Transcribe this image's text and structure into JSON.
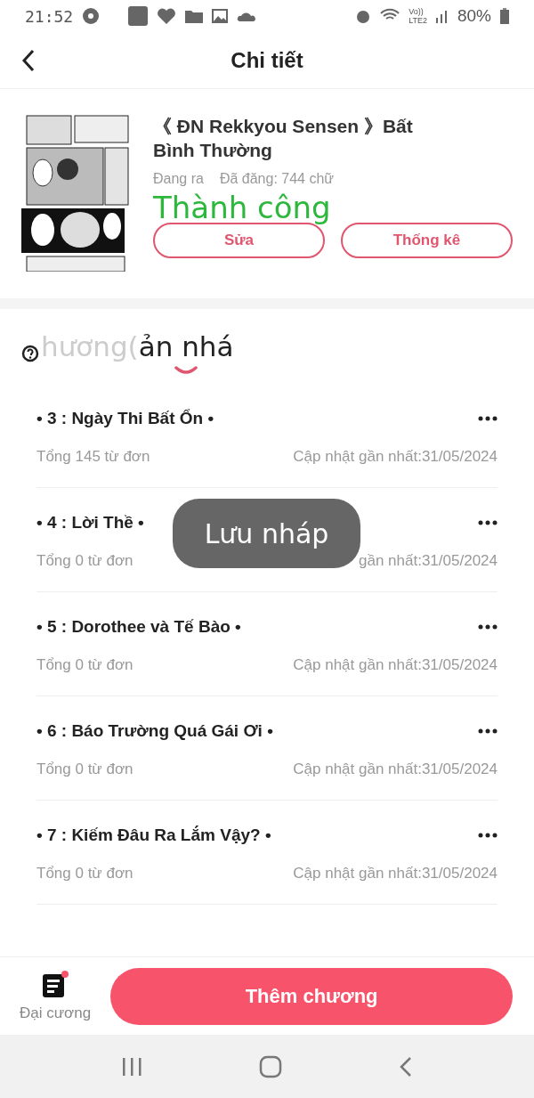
{
  "status_bar": {
    "time": "21:52",
    "network_top": "Vo))",
    "network_bottom": "LTE2",
    "battery": "80%"
  },
  "header": {
    "title": "Chi tiết"
  },
  "book": {
    "kind": "picture",
    "title": "《 ĐN Rekkyou Sensen 》Bất Bình Thường",
    "status": "Đang ra",
    "published": "Đã đăng: 744 chữ",
    "message": "Thành công",
    "buttons": [
      "Sửa",
      "Thống kê"
    ]
  },
  "tabs": [
    {
      "label": "hương(",
      "selected": false
    },
    {
      "label": "ản nhá",
      "selected": true
    }
  ],
  "chapters": [
    {
      "title": "• 3 : Ngày Thi Bất Ổn •",
      "words": "Tổng 145 từ đơn",
      "updated": "Cập nhật gần nhất:31/05/2024"
    },
    {
      "title": "• 4 : Lời Thề •",
      "words": "Tổng 0 từ đơn",
      "updated": "gần nhất:31/05/2024"
    },
    {
      "title": "• 5 : Dorothee và Tế Bào •",
      "words": "Tổng 0 từ đơn",
      "updated": "Cập nhật gần nhất:31/05/2024"
    },
    {
      "title": "• 6 : Báo Trường Quá Gái Ơi •",
      "words": "Tổng 0 từ đơn",
      "updated": "Cập nhật gần nhất:31/05/2024"
    },
    {
      "title": "• 7 : Kiếm Đâu Ra Lắm Vậy? •",
      "words": "Tổng 0 từ đơn",
      "updated": "Cập nhật gần nhất:31/05/2024"
    }
  ],
  "toast": "Lưu nháp",
  "footer": {
    "outline_label": "Đại cương",
    "outline_badge": true,
    "add_button": "Thêm chương"
  }
}
